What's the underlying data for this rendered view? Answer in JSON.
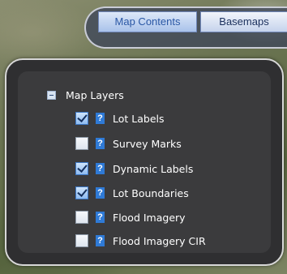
{
  "tabs": {
    "map_contents": "Map Contents",
    "basemaps": "Basemaps"
  },
  "tree": {
    "root_label": "Map Layers",
    "help_glyph": "?",
    "layers": [
      {
        "label": "Lot Labels",
        "checked": true
      },
      {
        "label": "Survey Marks",
        "checked": false
      },
      {
        "label": "Dynamic Labels",
        "checked": true
      },
      {
        "label": "Lot Boundaries",
        "checked": true
      },
      {
        "label": "Flood Imagery",
        "checked": false
      },
      {
        "label": "Flood Imagery CIR",
        "checked": false
      }
    ]
  },
  "colors": {
    "panel_bg": "#3b3b3d",
    "help_icon": "#2f7ad6",
    "tab_active_text": "#2a57a5"
  },
  "icons": {
    "collapse": "minus-box-icon",
    "help": "question-icon",
    "checkbox": "checkbox-icon"
  }
}
